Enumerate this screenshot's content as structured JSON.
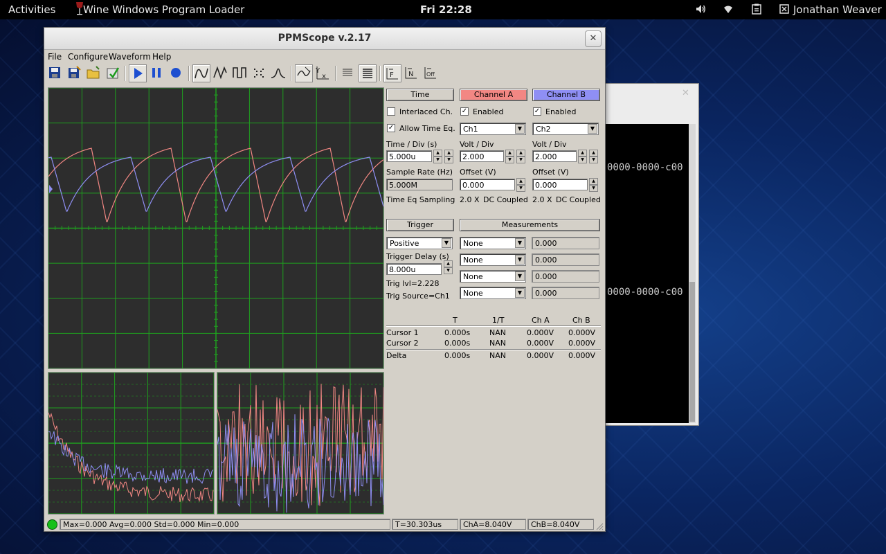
{
  "topbar": {
    "activities": "Activities",
    "app_name": "Wine Windows Program Loader",
    "clock": "Fri 22:28",
    "user": "Jonathan Weaver"
  },
  "background_window": {
    "line1": "0000-0000-c00",
    "line2": "0000-0000-c00"
  },
  "window": {
    "title": "PPMScope v.2.17"
  },
  "menu": {
    "file": "File",
    "configure": "Configure",
    "waveform": "Waveform",
    "help": "Help"
  },
  "toolbar": {
    "icons": [
      "save-icon",
      "save-as-icon",
      "open-icon",
      "export-icon",
      "play-icon",
      "pause-icon",
      "record-icon",
      "sine-wave-icon",
      "triangle-wave-icon",
      "square-wave-icon",
      "dots-icon",
      "pulse-icon",
      "xy-trace-icon",
      "y-x-icon",
      "lines-thin-icon",
      "lines-thick-icon",
      "trigger-f-icon",
      "trigger-n-icon",
      "trigger-off-icon"
    ]
  },
  "time_panel": {
    "header": "Time",
    "interlaced_label": "Interlaced Ch.",
    "interlaced_checked": false,
    "allow_time_eq_label": "Allow Time Eq.",
    "allow_time_eq_checked": true,
    "time_div_label": "Time / Div (s)",
    "time_div_value": "5.000u",
    "sample_rate_label": "Sample Rate (Hz)",
    "sample_rate_value": "5.000M",
    "mode_text": "Time Eq Sampling"
  },
  "channel_a": {
    "header": "Channel A",
    "enabled_label": "Enabled",
    "enabled": true,
    "source": "Ch1",
    "volt_div_label": "Volt / Div",
    "volt_div_value": "2.000",
    "offset_label": "Offset (V)",
    "offset_value": "0.000",
    "gain": "2.0 X",
    "coupling": "DC Coupled",
    "color": "#f28783"
  },
  "channel_b": {
    "header": "Channel B",
    "enabled_label": "Enabled",
    "enabled": true,
    "source": "Ch2",
    "volt_div_label": "Volt / Div",
    "volt_div_value": "2.000",
    "offset_label": "Offset (V)",
    "offset_value": "0.000",
    "gain": "2.0 X",
    "coupling": "DC Coupled",
    "color": "#8f8ff4"
  },
  "trigger": {
    "header": "Trigger",
    "mode": "Positive",
    "delay_label": "Trigger Delay (s)",
    "delay_value": "8.000u",
    "level_text": "Trig lvl=2.228",
    "source_text": "Trig Source=Ch1"
  },
  "measurements": {
    "header": "Measurements",
    "rows": [
      {
        "type": "None",
        "value": "0.000"
      },
      {
        "type": "None",
        "value": "0.000"
      },
      {
        "type": "None",
        "value": "0.000"
      },
      {
        "type": "None",
        "value": "0.000"
      }
    ]
  },
  "cursors": {
    "headers": [
      "T",
      "1/T",
      "Ch A",
      "Ch B"
    ],
    "rows": [
      {
        "label": "Cursor 1",
        "t": "0.000s",
        "inv": "NAN",
        "cha": "0.000V",
        "chb": "0.000V"
      },
      {
        "label": "Cursor 2",
        "t": "0.000s",
        "inv": "NAN",
        "cha": "0.000V",
        "chb": "0.000V"
      },
      {
        "label": "Delta",
        "t": "0.000s",
        "inv": "NAN",
        "cha": "0.000V",
        "chb": "0.000V"
      }
    ]
  },
  "status": {
    "stats": "Max=0.000  Avg=0.000  Std=0.000  Min=0.000",
    "period": "T=30.303us",
    "cha": "ChA=8.040V",
    "chb": "ChB=8.040V"
  },
  "colors": {
    "grid": "#1fa01f",
    "trace_a": "#f28783",
    "trace_b": "#8f8ff4",
    "screen_bg": "#2d2d2d",
    "status_led": "#18c018"
  }
}
